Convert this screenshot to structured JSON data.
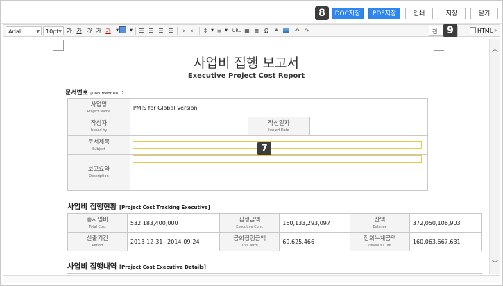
{
  "topbar": {
    "buttons": [
      {
        "label": "DOC저장",
        "style": "blue"
      },
      {
        "label": "PDF저장",
        "style": "blue"
      },
      {
        "label": "인쇄",
        "style": "white"
      },
      {
        "label": "저장",
        "style": "white"
      },
      {
        "label": "닫기",
        "style": "white"
      }
    ],
    "badge_8": "8",
    "badge_9": "9",
    "badge_7": "7"
  },
  "toolbar": {
    "font_family": "Arial",
    "font_size": "10pt",
    "icons": [
      "가",
      "가",
      "가",
      "가",
      "가"
    ],
    "url_label": "URL",
    "preview_label": "전",
    "html_label": "HTML"
  },
  "doc": {
    "title": "사업비 집행 보고서",
    "subtitle": "Executive Project Cost Report",
    "doc_no_label": "문서번호",
    "doc_no_label_en": "[Document No]",
    "doc_no_colon": ":",
    "info": {
      "project_name_ko": "사업명",
      "project_name_en": "Project Name",
      "project_name_value": "PMIS for Global Version",
      "issued_by_ko": "작성자",
      "issued_by_en": "Issued by",
      "issued_date_ko": "작성일자",
      "issued_date_en": "Issued Date",
      "subject_ko": "문서제목",
      "subject_en": "Subject",
      "description_ko": "보고요약",
      "description_en": "Description"
    },
    "tracking": {
      "heading_ko": "사업비 집행현황",
      "heading_en": "[Project Cost Tracking Executive]",
      "total_cost_ko": "총사업비",
      "total_cost_en": "Total Cost",
      "total_cost_value": "532,183,400,000",
      "exec_cum_ko": "집행금액",
      "exec_cum_en": "Executive Cum.",
      "exec_cum_value": "160,133,293,097",
      "balance_ko": "잔액",
      "balance_en": "Balance",
      "balance_value": "372,050,106,903",
      "period_ko": "산출기간",
      "period_en": "Period",
      "period_value": "2013-12-31~2014-09-24",
      "this_term_ko": "금회집행금액",
      "this_term_en": "This Term",
      "this_term_value": "69,625,466",
      "prev_cum_ko": "전회누계금액",
      "prev_cum_en": "Previous Cum.",
      "prev_cum_value": "160,063,667,631"
    },
    "details": {
      "heading_ko": "사업비 집행내역",
      "heading_en": "[Project Cost Executive Details]"
    }
  }
}
